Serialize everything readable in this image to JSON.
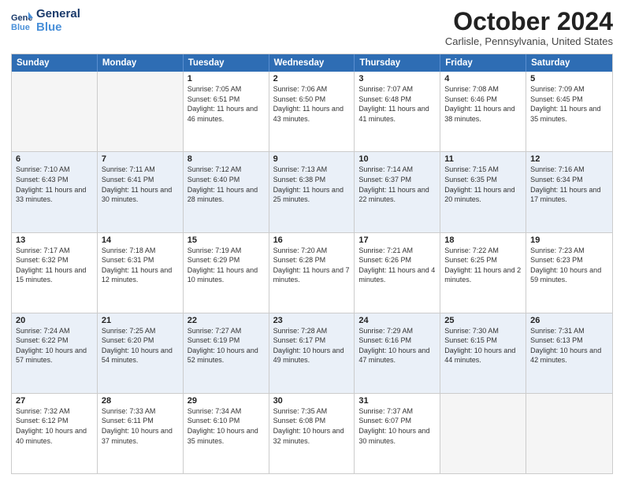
{
  "logo": {
    "line1": "General",
    "line2": "Blue"
  },
  "title": "October 2024",
  "location": "Carlisle, Pennsylvania, United States",
  "days_of_week": [
    "Sunday",
    "Monday",
    "Tuesday",
    "Wednesday",
    "Thursday",
    "Friday",
    "Saturday"
  ],
  "weeks": [
    [
      {
        "day": "",
        "info": ""
      },
      {
        "day": "",
        "info": ""
      },
      {
        "day": "1",
        "info": "Sunrise: 7:05 AM\nSunset: 6:51 PM\nDaylight: 11 hours and 46 minutes."
      },
      {
        "day": "2",
        "info": "Sunrise: 7:06 AM\nSunset: 6:50 PM\nDaylight: 11 hours and 43 minutes."
      },
      {
        "day": "3",
        "info": "Sunrise: 7:07 AM\nSunset: 6:48 PM\nDaylight: 11 hours and 41 minutes."
      },
      {
        "day": "4",
        "info": "Sunrise: 7:08 AM\nSunset: 6:46 PM\nDaylight: 11 hours and 38 minutes."
      },
      {
        "day": "5",
        "info": "Sunrise: 7:09 AM\nSunset: 6:45 PM\nDaylight: 11 hours and 35 minutes."
      }
    ],
    [
      {
        "day": "6",
        "info": "Sunrise: 7:10 AM\nSunset: 6:43 PM\nDaylight: 11 hours and 33 minutes."
      },
      {
        "day": "7",
        "info": "Sunrise: 7:11 AM\nSunset: 6:41 PM\nDaylight: 11 hours and 30 minutes."
      },
      {
        "day": "8",
        "info": "Sunrise: 7:12 AM\nSunset: 6:40 PM\nDaylight: 11 hours and 28 minutes."
      },
      {
        "day": "9",
        "info": "Sunrise: 7:13 AM\nSunset: 6:38 PM\nDaylight: 11 hours and 25 minutes."
      },
      {
        "day": "10",
        "info": "Sunrise: 7:14 AM\nSunset: 6:37 PM\nDaylight: 11 hours and 22 minutes."
      },
      {
        "day": "11",
        "info": "Sunrise: 7:15 AM\nSunset: 6:35 PM\nDaylight: 11 hours and 20 minutes."
      },
      {
        "day": "12",
        "info": "Sunrise: 7:16 AM\nSunset: 6:34 PM\nDaylight: 11 hours and 17 minutes."
      }
    ],
    [
      {
        "day": "13",
        "info": "Sunrise: 7:17 AM\nSunset: 6:32 PM\nDaylight: 11 hours and 15 minutes."
      },
      {
        "day": "14",
        "info": "Sunrise: 7:18 AM\nSunset: 6:31 PM\nDaylight: 11 hours and 12 minutes."
      },
      {
        "day": "15",
        "info": "Sunrise: 7:19 AM\nSunset: 6:29 PM\nDaylight: 11 hours and 10 minutes."
      },
      {
        "day": "16",
        "info": "Sunrise: 7:20 AM\nSunset: 6:28 PM\nDaylight: 11 hours and 7 minutes."
      },
      {
        "day": "17",
        "info": "Sunrise: 7:21 AM\nSunset: 6:26 PM\nDaylight: 11 hours and 4 minutes."
      },
      {
        "day": "18",
        "info": "Sunrise: 7:22 AM\nSunset: 6:25 PM\nDaylight: 11 hours and 2 minutes."
      },
      {
        "day": "19",
        "info": "Sunrise: 7:23 AM\nSunset: 6:23 PM\nDaylight: 10 hours and 59 minutes."
      }
    ],
    [
      {
        "day": "20",
        "info": "Sunrise: 7:24 AM\nSunset: 6:22 PM\nDaylight: 10 hours and 57 minutes."
      },
      {
        "day": "21",
        "info": "Sunrise: 7:25 AM\nSunset: 6:20 PM\nDaylight: 10 hours and 54 minutes."
      },
      {
        "day": "22",
        "info": "Sunrise: 7:27 AM\nSunset: 6:19 PM\nDaylight: 10 hours and 52 minutes."
      },
      {
        "day": "23",
        "info": "Sunrise: 7:28 AM\nSunset: 6:17 PM\nDaylight: 10 hours and 49 minutes."
      },
      {
        "day": "24",
        "info": "Sunrise: 7:29 AM\nSunset: 6:16 PM\nDaylight: 10 hours and 47 minutes."
      },
      {
        "day": "25",
        "info": "Sunrise: 7:30 AM\nSunset: 6:15 PM\nDaylight: 10 hours and 44 minutes."
      },
      {
        "day": "26",
        "info": "Sunrise: 7:31 AM\nSunset: 6:13 PM\nDaylight: 10 hours and 42 minutes."
      }
    ],
    [
      {
        "day": "27",
        "info": "Sunrise: 7:32 AM\nSunset: 6:12 PM\nDaylight: 10 hours and 40 minutes."
      },
      {
        "day": "28",
        "info": "Sunrise: 7:33 AM\nSunset: 6:11 PM\nDaylight: 10 hours and 37 minutes."
      },
      {
        "day": "29",
        "info": "Sunrise: 7:34 AM\nSunset: 6:10 PM\nDaylight: 10 hours and 35 minutes."
      },
      {
        "day": "30",
        "info": "Sunrise: 7:35 AM\nSunset: 6:08 PM\nDaylight: 10 hours and 32 minutes."
      },
      {
        "day": "31",
        "info": "Sunrise: 7:37 AM\nSunset: 6:07 PM\nDaylight: 10 hours and 30 minutes."
      },
      {
        "day": "",
        "info": ""
      },
      {
        "day": "",
        "info": ""
      }
    ]
  ]
}
